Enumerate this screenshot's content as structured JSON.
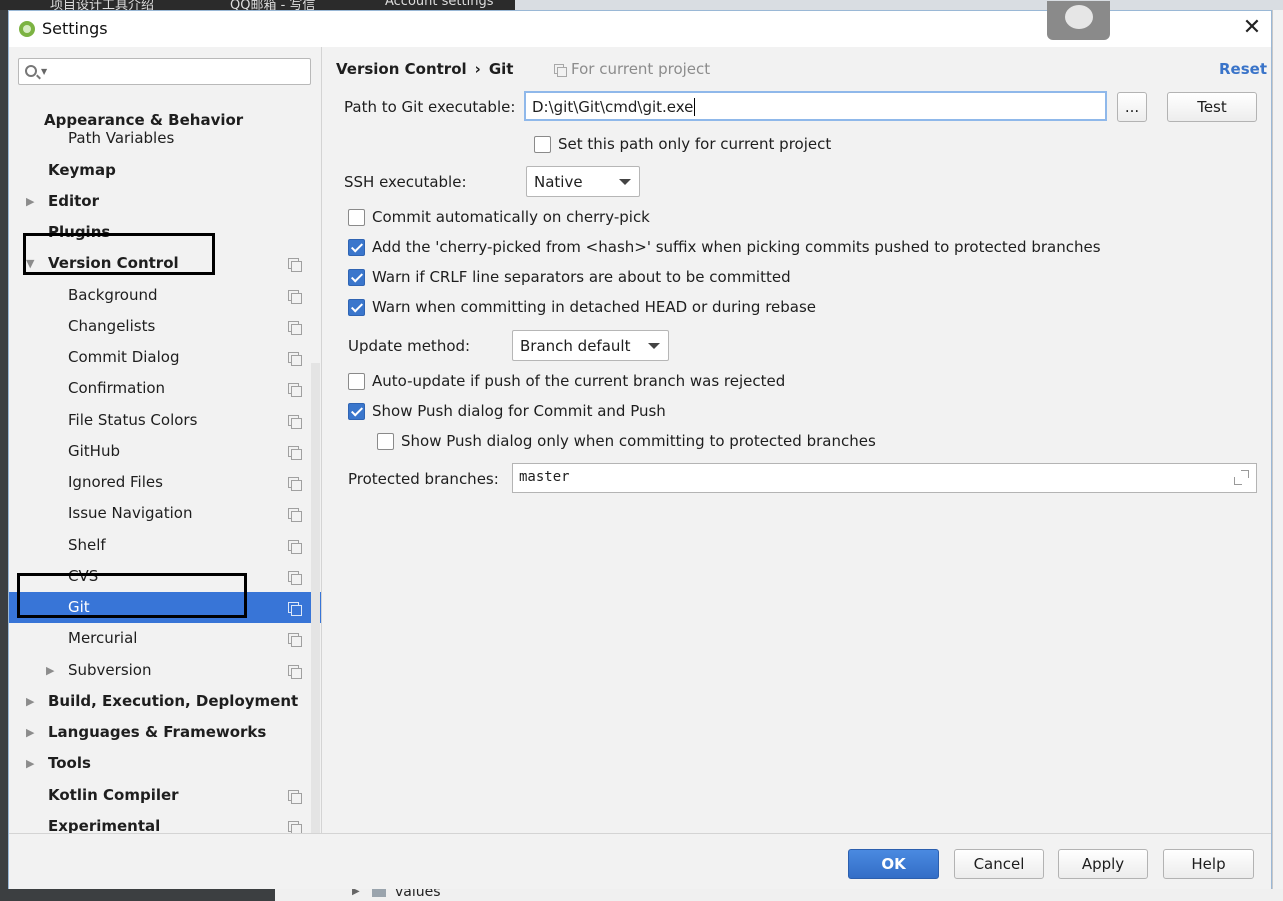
{
  "dialog": {
    "title": "Settings",
    "close_icon": "close-icon"
  },
  "background": {
    "tab_text_1": "项目设计工具介绍",
    "tab_text_2": "QQ邮箱 - 写信",
    "tab_text_3": "Account settings",
    "bottom_tree_label": "values"
  },
  "sidebar": {
    "search_placeholder": "",
    "items": [
      {
        "label": "Appearance & Behavior",
        "bold": true
      },
      {
        "label": "Path Variables",
        "bold": false
      },
      {
        "label": "Keymap",
        "bold": true
      },
      {
        "label": "Editor",
        "bold": true
      },
      {
        "label": "Plugins",
        "bold": true
      },
      {
        "label": "Version Control",
        "bold": true
      },
      {
        "label": "Background",
        "bold": false
      },
      {
        "label": "Changelists",
        "bold": false
      },
      {
        "label": "Commit Dialog",
        "bold": false
      },
      {
        "label": "Confirmation",
        "bold": false
      },
      {
        "label": "File Status Colors",
        "bold": false
      },
      {
        "label": "GitHub",
        "bold": false
      },
      {
        "label": "Ignored Files",
        "bold": false
      },
      {
        "label": "Issue Navigation",
        "bold": false
      },
      {
        "label": "Shelf",
        "bold": false
      },
      {
        "label": "CVS",
        "bold": false
      },
      {
        "label": "Git",
        "bold": false,
        "selected": true
      },
      {
        "label": "Mercurial",
        "bold": false
      },
      {
        "label": "Subversion",
        "bold": false
      },
      {
        "label": "Build, Execution, Deployment",
        "bold": true
      },
      {
        "label": "Languages & Frameworks",
        "bold": true
      },
      {
        "label": "Tools",
        "bold": true
      },
      {
        "label": "Kotlin Compiler",
        "bold": true
      },
      {
        "label": "Experimental",
        "bold": true
      }
    ]
  },
  "header": {
    "breadcrumb_parent": "Version Control",
    "breadcrumb_sep": "›",
    "breadcrumb_current": "Git",
    "for_current_project": "For current project",
    "reset": "Reset"
  },
  "git": {
    "path_label": "Path to Git executable:",
    "path_value": "D:\\git\\Git\\cmd\\git.exe",
    "browse_label": "...",
    "test_label": "Test",
    "path_only_project_label": "Set this path only for current project",
    "path_only_project_checked": false,
    "ssh_label": "SSH executable:",
    "ssh_value": "Native",
    "commit_cherry_pick_label": "Commit automatically on cherry-pick",
    "commit_cherry_pick_checked": false,
    "cherry_suffix_label": "Add the 'cherry-picked from <hash>' suffix when picking commits pushed to protected branches",
    "cherry_suffix_checked": true,
    "warn_crlf_label": "Warn if CRLF line separators are about to be committed",
    "warn_crlf_checked": true,
    "warn_detached_label": "Warn when committing in detached HEAD or during rebase",
    "warn_detached_checked": true,
    "update_method_label": "Update method:",
    "update_method_value": "Branch default",
    "auto_update_label": "Auto-update if push of the current branch was rejected",
    "auto_update_checked": false,
    "show_push_label": "Show Push dialog for Commit and Push",
    "show_push_checked": true,
    "show_push_protected_label": "Show Push dialog only when committing to protected branches",
    "show_push_protected_checked": false,
    "protected_branches_label": "Protected branches:",
    "protected_branches_value": "master"
  },
  "footer": {
    "ok": "OK",
    "cancel": "Cancel",
    "apply": "Apply",
    "help": "Help"
  },
  "colors": {
    "selection": "#3875d7",
    "accent_link": "#3a74c9",
    "checkbox_checked": "#3a76cc"
  }
}
